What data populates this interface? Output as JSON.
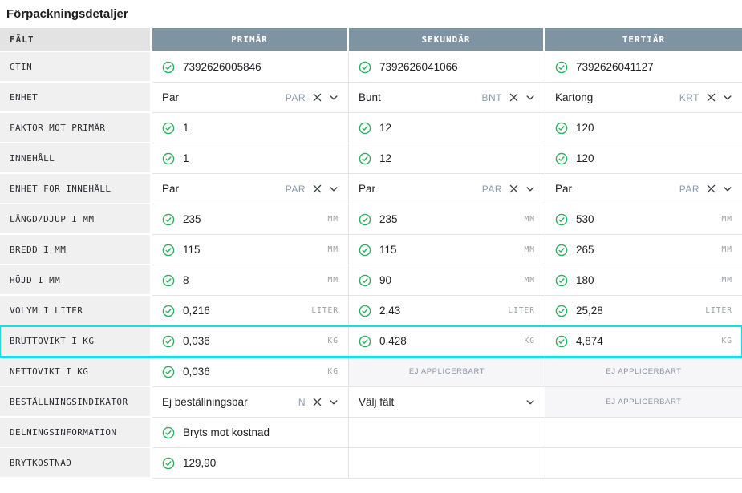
{
  "page": {
    "title": "Förpackningsdetaljer"
  },
  "colors": {
    "header_bg": "#7e94a3",
    "field_header_bg": "#e3e3e4",
    "row_label_bg": "#f0f0f1",
    "na_cell_bg": "#f6f6f8",
    "check_green": "#2bae5f",
    "highlight_cyan": "#15e0e8",
    "abbr_blue_gray": "#8a9bad",
    "unit_gray": "#9aa0a6"
  },
  "table": {
    "columns": [
      "FÄLT",
      "PRIMÄR",
      "SEKUNDÄR",
      "TERTIÄR"
    ],
    "na_text": "EJ APPLICERBART",
    "rows": [
      {
        "field": "GTIN",
        "cells": [
          {
            "type": "value",
            "check": true,
            "text": "7392626005846"
          },
          {
            "type": "value",
            "check": true,
            "text": "7392626041066"
          },
          {
            "type": "value",
            "check": true,
            "text": "7392626041127"
          }
        ]
      },
      {
        "field": "ENHET",
        "cells": [
          {
            "type": "dropdown",
            "text": "Par",
            "abbr": "PAR"
          },
          {
            "type": "dropdown",
            "text": "Bunt",
            "abbr": "BNT"
          },
          {
            "type": "dropdown",
            "text": "Kartong",
            "abbr": "KRT"
          }
        ]
      },
      {
        "field": "FAKTOR MOT PRIMÄR",
        "cells": [
          {
            "type": "value",
            "check": true,
            "text": "1"
          },
          {
            "type": "value",
            "check": true,
            "text": "12"
          },
          {
            "type": "value",
            "check": true,
            "text": "120"
          }
        ]
      },
      {
        "field": "INNEHÅLL",
        "cells": [
          {
            "type": "value",
            "check": true,
            "text": "1"
          },
          {
            "type": "value",
            "check": true,
            "text": "12"
          },
          {
            "type": "value",
            "check": true,
            "text": "120"
          }
        ]
      },
      {
        "field": "ENHET FÖR INNEHÅLL",
        "cells": [
          {
            "type": "dropdown",
            "text": "Par",
            "abbr": "PAR"
          },
          {
            "type": "dropdown",
            "text": "Par",
            "abbr": "PAR"
          },
          {
            "type": "dropdown",
            "text": "Par",
            "abbr": "PAR"
          }
        ]
      },
      {
        "field": "LÄNGD/DJUP I MM",
        "cells": [
          {
            "type": "value",
            "check": true,
            "text": "235",
            "unit": "MM"
          },
          {
            "type": "value",
            "check": true,
            "text": "235",
            "unit": "MM"
          },
          {
            "type": "value",
            "check": true,
            "text": "530",
            "unit": "MM"
          }
        ]
      },
      {
        "field": "BREDD I MM",
        "cells": [
          {
            "type": "value",
            "check": true,
            "text": "115",
            "unit": "MM"
          },
          {
            "type": "value",
            "check": true,
            "text": "115",
            "unit": "MM"
          },
          {
            "type": "value",
            "check": true,
            "text": "265",
            "unit": "MM"
          }
        ]
      },
      {
        "field": "HÖJD I MM",
        "cells": [
          {
            "type": "value",
            "check": true,
            "text": "8",
            "unit": "MM"
          },
          {
            "type": "value",
            "check": true,
            "text": "90",
            "unit": "MM"
          },
          {
            "type": "value",
            "check": true,
            "text": "180",
            "unit": "MM"
          }
        ]
      },
      {
        "field": "VOLYM I LITER",
        "cells": [
          {
            "type": "value",
            "check": true,
            "text": "0,216",
            "unit": "LITER"
          },
          {
            "type": "value",
            "check": true,
            "text": "2,43",
            "unit": "LITER"
          },
          {
            "type": "value",
            "check": true,
            "text": "25,28",
            "unit": "LITER"
          }
        ]
      },
      {
        "field": "BRUTTOVIKT I KG",
        "highlight": true,
        "cells": [
          {
            "type": "value",
            "check": true,
            "text": "0,036",
            "unit": "KG"
          },
          {
            "type": "value",
            "check": true,
            "text": "0,428",
            "unit": "KG"
          },
          {
            "type": "value",
            "check": true,
            "text": "4,874",
            "unit": "KG"
          }
        ]
      },
      {
        "field": "NETTOVIKT I KG",
        "cells": [
          {
            "type": "value",
            "check": true,
            "text": "0,036",
            "unit": "KG"
          },
          {
            "type": "na"
          },
          {
            "type": "na"
          }
        ]
      },
      {
        "field": "BESTÄLLNINGSINDIKATOR",
        "cells": [
          {
            "type": "dropdown",
            "text": "Ej beställningsbar",
            "abbr": "N"
          },
          {
            "type": "select",
            "text": "Välj fält"
          },
          {
            "type": "na"
          }
        ]
      },
      {
        "field": "DELNINGSINFORMATION",
        "cells": [
          {
            "type": "value",
            "check": true,
            "text": "Bryts mot kostnad"
          },
          {
            "type": "empty"
          },
          {
            "type": "empty"
          }
        ]
      },
      {
        "field": "BRYTKOSTNAD",
        "cells": [
          {
            "type": "value",
            "check": true,
            "text": "129,90"
          },
          {
            "type": "empty"
          },
          {
            "type": "empty"
          }
        ]
      }
    ]
  }
}
